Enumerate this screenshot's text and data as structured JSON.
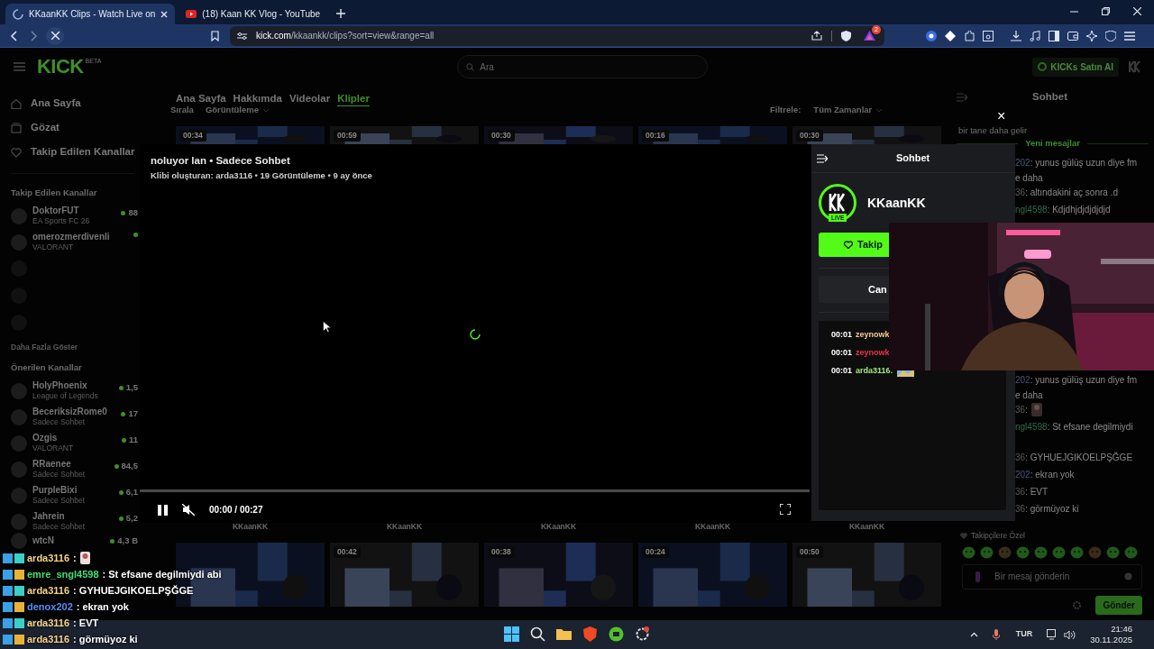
{
  "browser": {
    "tabs": [
      {
        "title": "KKaanKK Clips - Watch Live on",
        "selected": true,
        "kind": "loading"
      },
      {
        "title": "(18) Kaan KK Vlog - YouTube",
        "selected": false,
        "kind": "youtube"
      }
    ],
    "url_host": "kick.com",
    "url_path": "/kkaankk/clips?sort=view&range=all",
    "shield_count": "2"
  },
  "header": {
    "logo": "KICK",
    "logo_tag": "BETA",
    "search_placeholder": "Ara",
    "kicks_button": "KICKs Satın Al"
  },
  "sidebar": {
    "nav": [
      {
        "label": "Ana Sayfa",
        "kind": "home"
      },
      {
        "label": "Gözat",
        "kind": "browse"
      },
      {
        "label": "Takip Edilen Kanallar",
        "kind": "heart"
      }
    ],
    "followed_title": "Takip Edilen Kanallar",
    "followed": [
      {
        "name": "DoktorFUT",
        "category": "EA Sports FC 26",
        "viewers": "88"
      },
      {
        "name": "omerozmerdivenli",
        "category": "VALORANT"
      },
      {
        "kind": "faded"
      },
      {
        "kind": "faded"
      },
      {
        "kind": "faded"
      }
    ],
    "show_more": "Daha Fazla Göster",
    "recommended_title": "Önerilen Kanallar",
    "recommended": [
      {
        "name": "HolyPhoenix",
        "category": "League of Legends",
        "viewers": "1,5"
      },
      {
        "name": "BeceriksizRome0",
        "category": "Sadece Sohbet",
        "viewers": "17"
      },
      {
        "name": "Ozgis",
        "category": "VALORANT",
        "viewers": "11"
      },
      {
        "name": "RRaenee",
        "category": "Sadece Sohbet",
        "viewers": "84,5"
      },
      {
        "name": "PurpleBixi",
        "category": "Sadece Sohbet",
        "viewers": "6,1"
      },
      {
        "name": "Jahrein",
        "category": "Sadece Sohbet",
        "viewers": "5,2"
      },
      {
        "name": "wtcN",
        "viewers": "4,3 B"
      }
    ]
  },
  "main": {
    "tabs": [
      {
        "label": "Ana Sayfa",
        "selected": false
      },
      {
        "label": "Hakkımda",
        "selected": false
      },
      {
        "label": "Videolar",
        "selected": false
      },
      {
        "label": "Klipler",
        "selected": true
      }
    ],
    "sort_label": "Sırala",
    "sort_value": "Görüntüleme",
    "filter_label": "Filtrele:",
    "filter_value": "Tüm Zamanlar",
    "top_clips": [
      {
        "duration": "00:34"
      },
      {
        "duration": "00:59"
      },
      {
        "duration": "00:30"
      },
      {
        "duration": "00:16"
      },
      {
        "duration": "00:30"
      }
    ],
    "clip_channels": [
      "KKaanKK",
      "KKaanKK",
      "KKaanKK",
      "KKaanKK",
      "KKaanKK"
    ],
    "bottom_clips": [
      {
        "kind": "picture"
      },
      {
        "duration": "00:42"
      },
      {
        "duration": "00:38"
      },
      {
        "duration": "00:24"
      },
      {
        "duration": "00:50"
      }
    ]
  },
  "player": {
    "title": "noluyor lan • Sadece Sohbet",
    "meta": "Klibi oluşturan: arda3116 • 19 Görüntüleme • 9 ay önce",
    "time": "00:00 / 00:27",
    "level": 0,
    "playing": true,
    "muted": true,
    "loading": true
  },
  "clip_chat": {
    "title": "Sohbet",
    "channel": "KKaanKK",
    "live_badge": "LIVE",
    "follow_button": "Takip",
    "second_button": "Can",
    "messages": [
      {
        "time": "00:01",
        "user": "zeynowk",
        "color": "#f3c98f"
      },
      {
        "time": "00:01",
        "user": "zeynowk",
        "color": "#e8344a"
      },
      {
        "time": "00:01",
        "user": "arda3116:",
        "color": "#a3e87a",
        "kind": "emote"
      }
    ]
  },
  "close_label": "×",
  "right_chat": {
    "title": "Sohbet",
    "top_text": "bir tane daha gelir",
    "new_messages": "Yeni mesajlar",
    "upper": [
      {
        "user": "202",
        "color": "#4a5478",
        "text": ": yunus gülüş uzun diye fm"
      },
      {
        "text": "e daha"
      },
      {
        "user": "36",
        "color": "#5a5a5a",
        "text": ": altındakini aç sonra .d"
      },
      {
        "user": "ngl4598",
        "color": "#2f6b4c",
        "text": ": Kdjdhjdjdjdjdjd"
      }
    ],
    "lower": [
      {
        "user": "202",
        "color": "#4a5478",
        "text": ": yunus gülüş uzun diye fm"
      },
      {
        "text": "e daha"
      },
      {
        "user": "36",
        "color": "#5a5a5a",
        "text": ":",
        "kind": "emote"
      },
      {
        "user": "ngl4598",
        "color": "#2f6b4c",
        "text": ": St efsane degilmiydi"
      },
      {
        "kind": "blank"
      },
      {
        "user": "36",
        "color": "#5a5a5a",
        "text": ": GYHUEJGIKOELPŞĞGE"
      },
      {
        "user": "202",
        "color": "#4a5478",
        "text": ": ekran yok"
      },
      {
        "user": "36",
        "color": "#5a5a5a",
        "text": ": EVT"
      },
      {
        "user": "36",
        "color": "#5a5a5a",
        "text": ": görmüyoz ki"
      }
    ],
    "followers_label": "Takipçilere Özel",
    "input_placeholder": "Bir mesaj gönderin",
    "send_button": "Gönder"
  },
  "overlay_chat": [
    {
      "user": "arda3116",
      "color": "#f6d38a",
      "text": ":",
      "kind": "emote"
    },
    {
      "user": "emre_sngl4598",
      "color": "#3fe07a",
      "text": ": St efsane degilmiydi abi"
    },
    {
      "user": "arda3116",
      "color": "#f6d38a",
      "text": ": GYHUEJGIKOELPŞĞGE"
    },
    {
      "user": "denox202",
      "color": "#5b8cf5",
      "text": ": ekran yok"
    },
    {
      "user": "arda3116",
      "color": "#f6d38a",
      "text": ": EVT"
    },
    {
      "user": "arda3116",
      "color": "#f6d38a",
      "text": ": görmüyoz ki"
    }
  ],
  "taskbar": {
    "language": "TUR",
    "time": "21:46",
    "date": "30.11.2025"
  }
}
